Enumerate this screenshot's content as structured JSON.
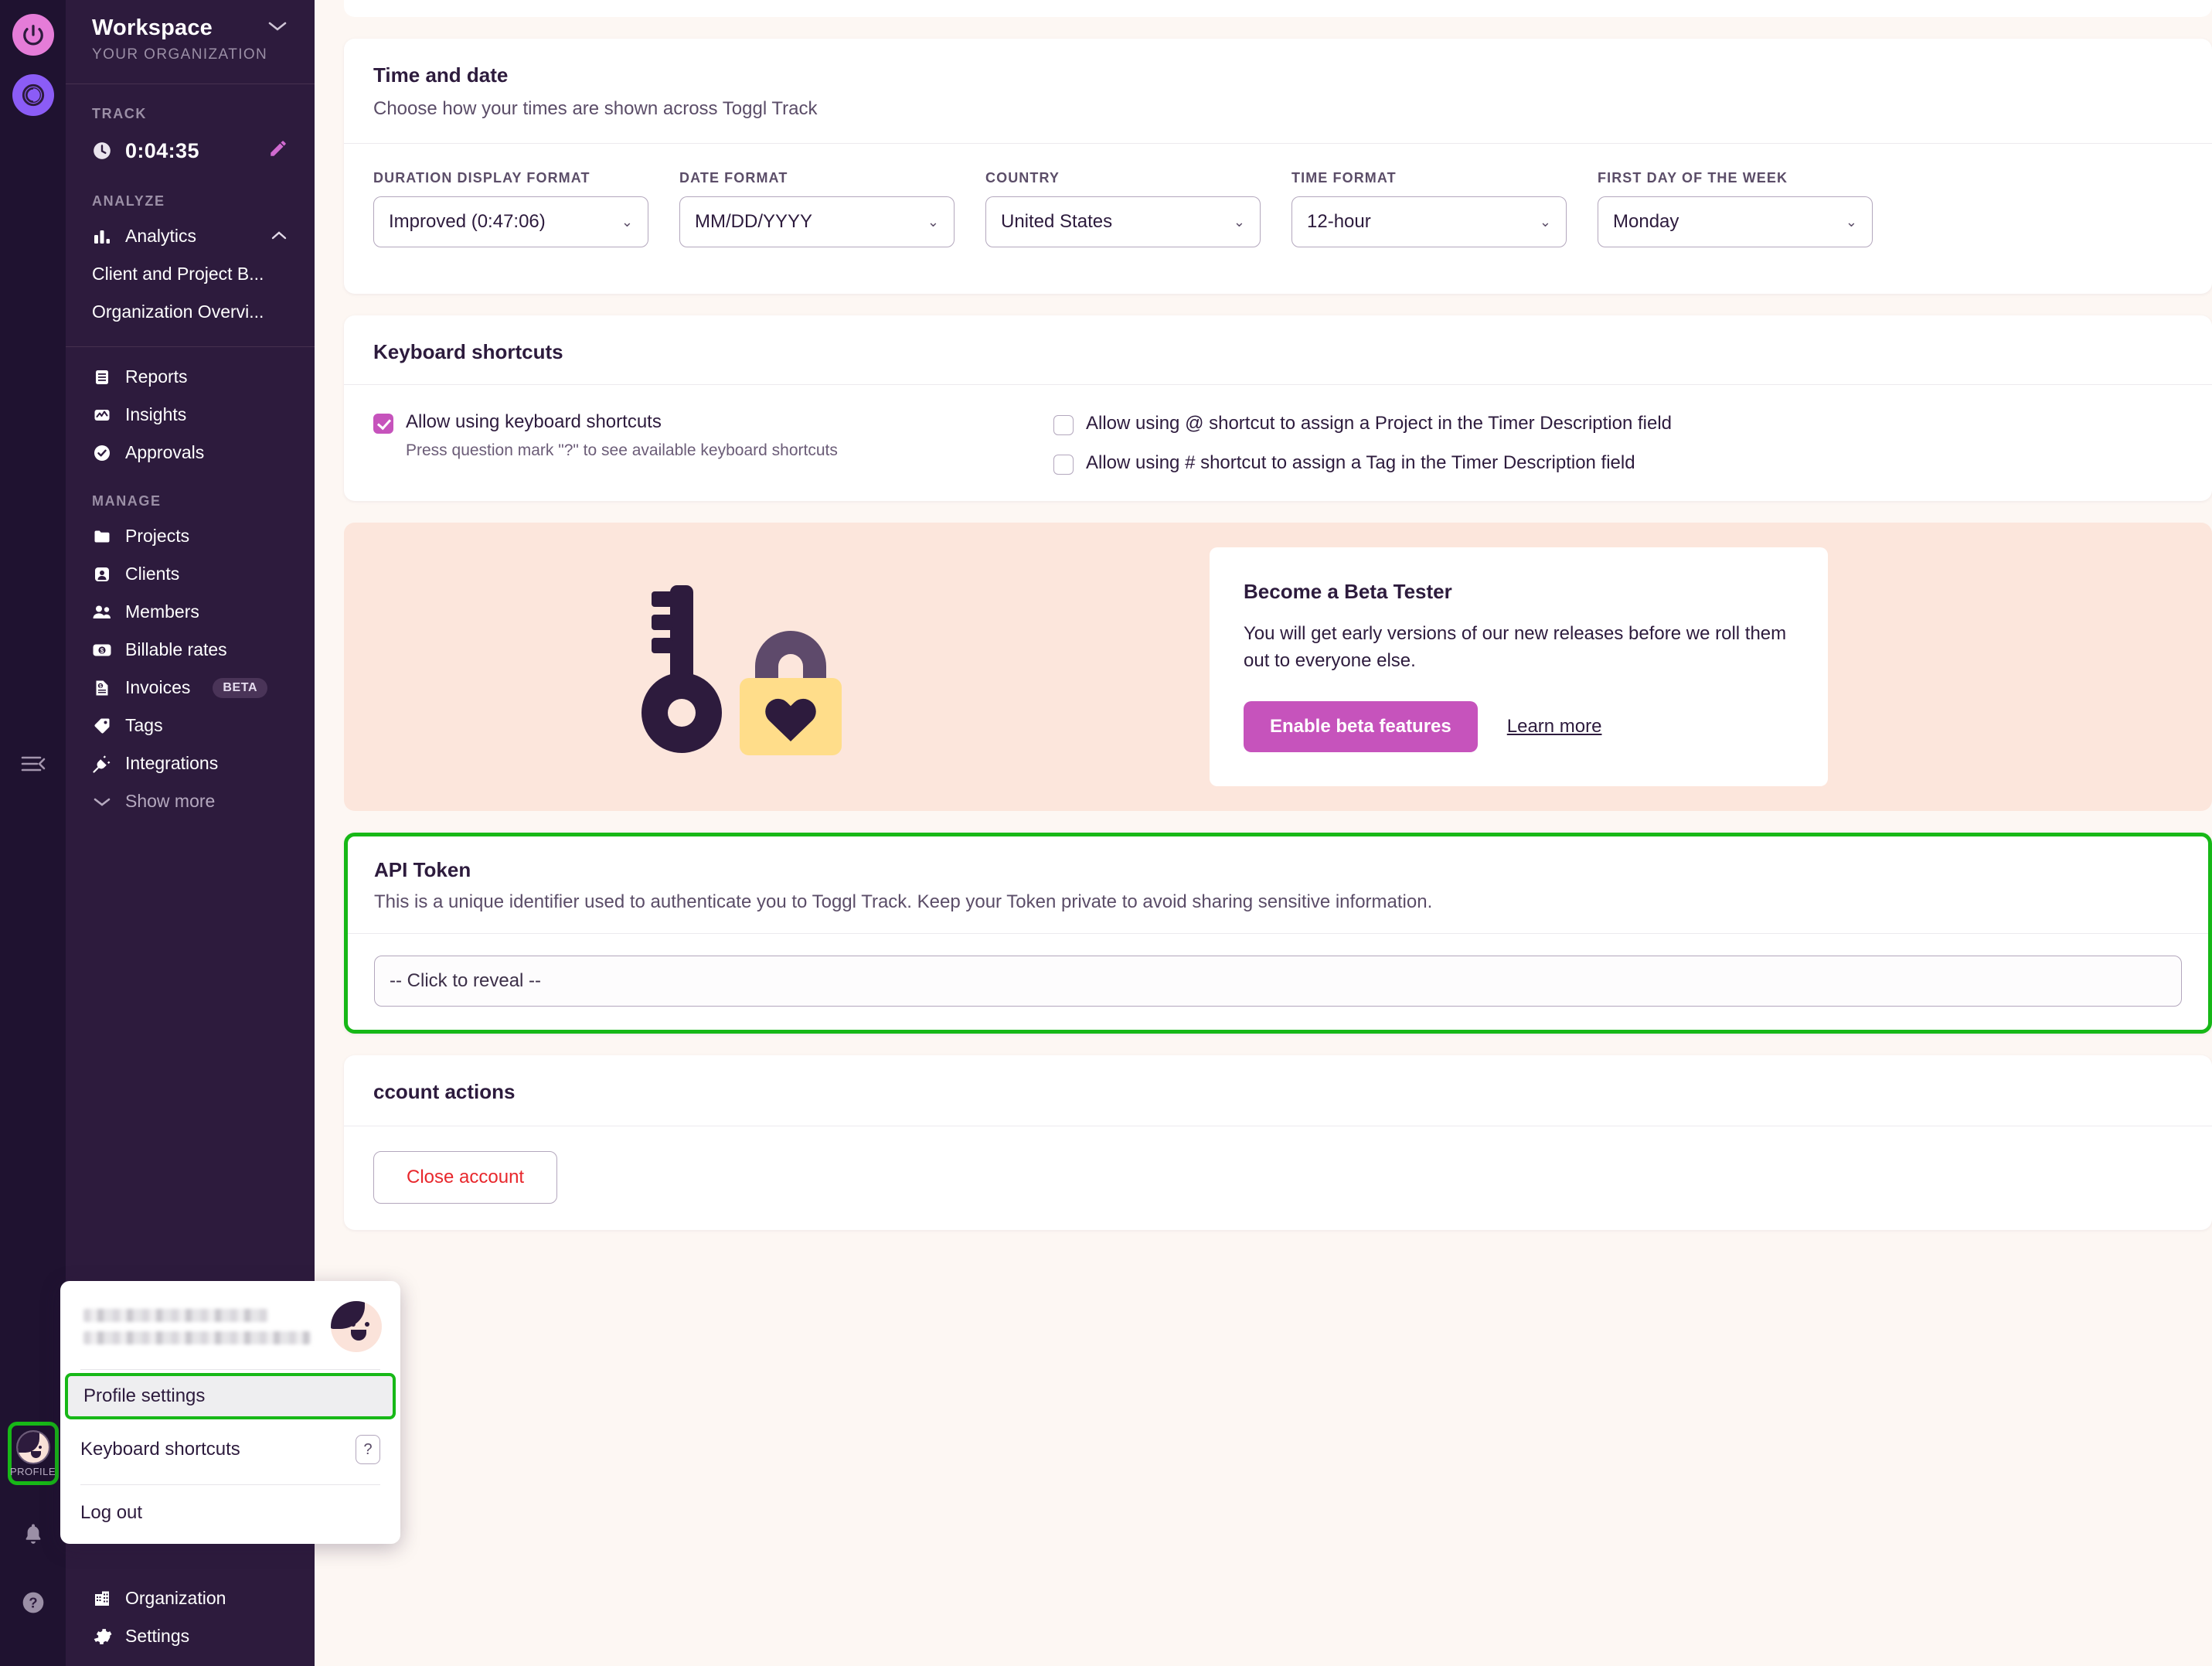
{
  "rail": {
    "logo_icon": "power-icon",
    "logo2_icon": "toggl-track-icon",
    "collapse_icon": "collapse-sidebar-icon",
    "profile_label": "PROFILE",
    "notifications_icon": "bell-icon",
    "help_icon": "question-circle-icon"
  },
  "sidebar": {
    "workspace_title": "Workspace",
    "workspace_subtitle": "YOUR ORGANIZATION",
    "groups": [
      {
        "label": "TRACK"
      },
      {
        "label": "ANALYZE"
      },
      {
        "label": "MANAGE"
      }
    ],
    "timer": {
      "value": "0:04:35",
      "icon": "clock-icon",
      "edit_icon": "pencil-icon"
    },
    "analytics": {
      "label": "Analytics",
      "icon": "bar-chart-icon",
      "chevron": "chevron-up-icon"
    },
    "analytics_children": [
      "Client and Project B...",
      "Organization Overvi..."
    ],
    "analyze_items": [
      {
        "label": "Reports",
        "icon": "document-list-icon"
      },
      {
        "label": "Insights",
        "icon": "pulse-chart-icon"
      },
      {
        "label": "Approvals",
        "icon": "check-circle-icon"
      }
    ],
    "manage_items": [
      {
        "label": "Projects",
        "icon": "folder-icon",
        "badge": ""
      },
      {
        "label": "Clients",
        "icon": "person-card-icon",
        "badge": ""
      },
      {
        "label": "Members",
        "icon": "people-icon",
        "badge": ""
      },
      {
        "label": "Billable rates",
        "icon": "money-icon",
        "badge": ""
      },
      {
        "label": "Invoices",
        "icon": "invoice-icon",
        "badge": "BETA"
      },
      {
        "label": "Tags",
        "icon": "tag-icon",
        "badge": ""
      },
      {
        "label": "Integrations",
        "icon": "plug-icon",
        "badge": ""
      }
    ],
    "show_more": {
      "label": "Show more",
      "icon": "chevron-down-icon"
    },
    "bottom_items": [
      {
        "label": "Organization",
        "icon": "building-icon"
      },
      {
        "label": "Settings",
        "icon": "gear-icon"
      }
    ]
  },
  "time_and_date": {
    "title": "Time and date",
    "description": "Choose how your times are shown across Toggl Track",
    "fields": [
      {
        "label": "DURATION DISPLAY FORMAT",
        "value": "Improved (0:47:06)"
      },
      {
        "label": "DATE FORMAT",
        "value": "MM/DD/YYYY"
      },
      {
        "label": "COUNTRY",
        "value": "United States"
      },
      {
        "label": "TIME FORMAT",
        "value": "12-hour"
      },
      {
        "label": "FIRST DAY OF THE WEEK",
        "value": "Monday"
      }
    ]
  },
  "keyboard_shortcuts": {
    "title": "Keyboard shortcuts",
    "main_checkbox": {
      "label": "Allow using keyboard shortcuts",
      "checked": true,
      "help": "Press question mark \"?\" to see available keyboard shortcuts"
    },
    "options": [
      {
        "label": "Allow using @ shortcut to assign a Project in the Timer Description field",
        "checked": false
      },
      {
        "label": "Allow using # shortcut to assign a Tag in the Timer Description field",
        "checked": false
      }
    ]
  },
  "beta": {
    "illustration": "key-and-heart-padlock-illustration",
    "title": "Become a Beta Tester",
    "body": "You will get early versions of our new releases before we roll them out to everyone else.",
    "primary_button": "Enable beta features",
    "link": "Learn more"
  },
  "api_token": {
    "title": "API Token",
    "description": "This is a unique identifier used to authenticate you to Toggl Track. Keep your Token private to avoid sharing sensitive information.",
    "field_value": "-- Click to reveal --",
    "highlight_color": "#17b817"
  },
  "account_actions": {
    "title": "ccount actions",
    "close_button": "Close account",
    "close_button_color": "#e8272c"
  },
  "profile_menu": {
    "name_redacted": "",
    "email_redacted": "",
    "items": [
      {
        "label": "Profile settings",
        "active": true,
        "badge": ""
      },
      {
        "label": "Keyboard shortcuts",
        "active": false,
        "badge": "?"
      },
      {
        "label": "Log out",
        "active": false,
        "badge": ""
      }
    ]
  },
  "colors": {
    "brand_pink": "#c653bc",
    "sidebar_bg": "#2d1b3d",
    "rail_bg": "#1f1230",
    "page_bg": "#fdf7f3",
    "highlight_green": "#17b817",
    "banner_bg": "#fce6dc",
    "padlock_yellow": "#ffdd8a"
  }
}
